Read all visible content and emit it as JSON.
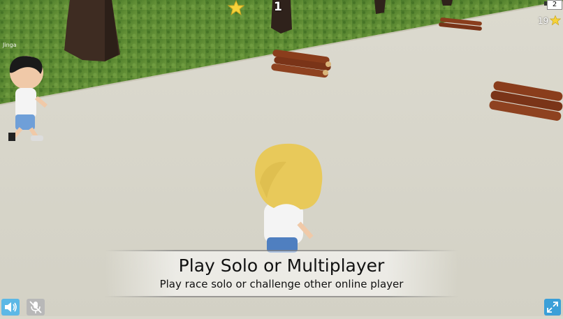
{
  "hud": {
    "checkpoint_count": "1",
    "rank": "2",
    "star_score": "19",
    "player_name": "Jinga"
  },
  "banner": {
    "title": "Play Solo or Multiplayer",
    "subtitle": "Play race solo or challenge other online player"
  },
  "controls": {
    "sound_icon": "speaker-icon",
    "mic_icon": "mic-muted-icon",
    "fullscreen_icon": "expand-icon"
  },
  "colors": {
    "grass": "#4f7a2c",
    "road": "#d9d7cc",
    "star": "#f6d33a",
    "hair": "#e8c95a",
    "log": "#8a3d1c",
    "sound_button": "#5cb8e6",
    "fullscreen_button": "#3a9fd8"
  }
}
